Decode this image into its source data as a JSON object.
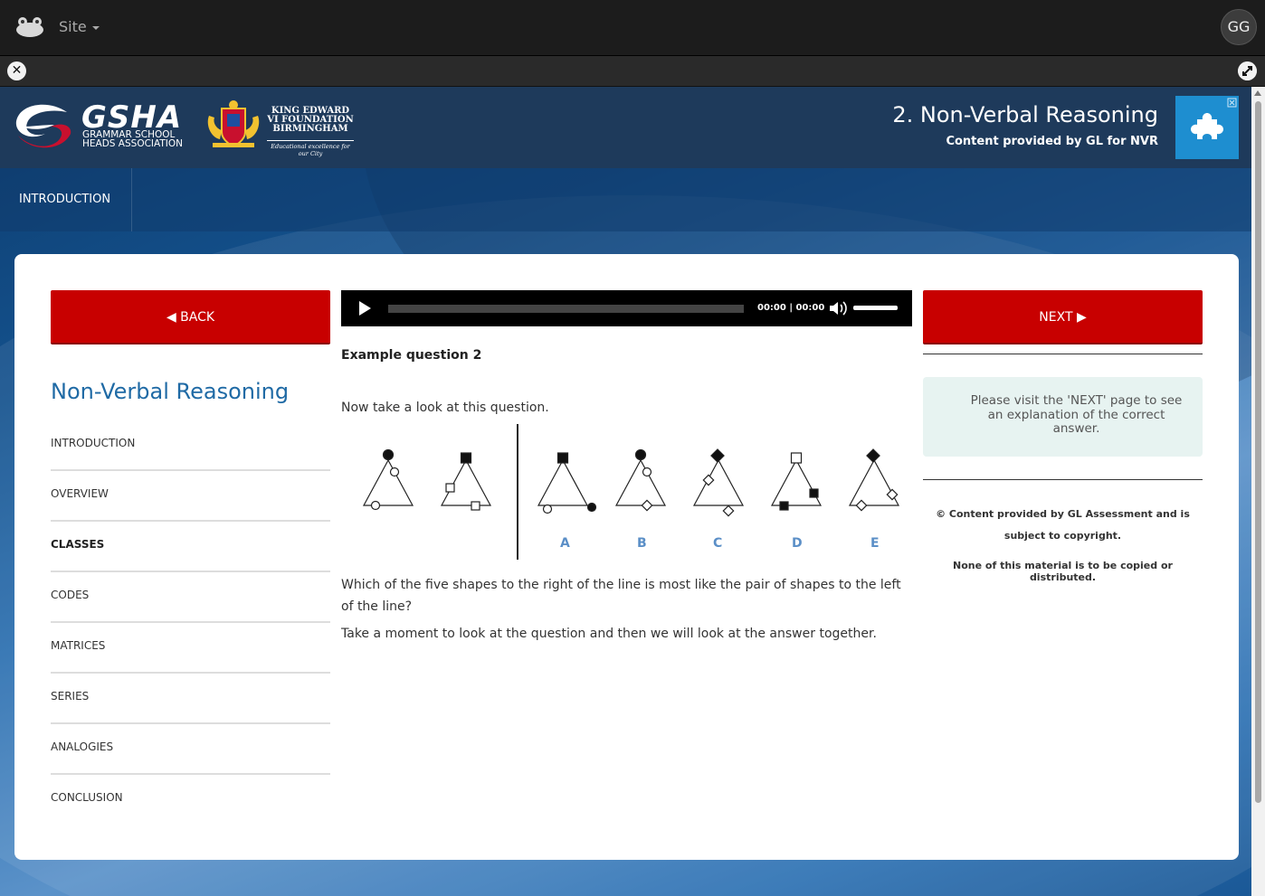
{
  "topbar": {
    "site_label": "Site",
    "avatar_initials": "GG"
  },
  "header": {
    "gsha_logo_text": "GSHA",
    "gsha_subtitle": "GRAMMAR SCHOOL HEADS ASSOCIATION",
    "kes_name": "KING EDWARD VI FOUNDATION BIRMINGHAM",
    "kes_tagline": "Educational excellence for our City",
    "title": "2. Non-Verbal Reasoning",
    "subtitle": "Content provided by GL for NVR",
    "tile_icon": "puzzle-icon"
  },
  "nav": {
    "active_tab": "INTRODUCTION"
  },
  "left": {
    "back_label": "◀ BACK",
    "section_title": "Non-Verbal Reasoning",
    "items": [
      {
        "label": "INTRODUCTION"
      },
      {
        "label": "OVERVIEW"
      },
      {
        "label": "CLASSES"
      },
      {
        "label": "CODES"
      },
      {
        "label": "MATRICES"
      },
      {
        "label": "SERIES"
      },
      {
        "label": "ANALOGIES"
      },
      {
        "label": "CONCLUSION"
      }
    ],
    "active_item": "CLASSES"
  },
  "player": {
    "time": "00:00 | 00:00"
  },
  "question": {
    "heading": "Example question 2",
    "intro": "Now take a look at this question.",
    "option_labels": [
      "A",
      "B",
      "C",
      "D",
      "E"
    ],
    "text": "Which of the five shapes to the right of the line is most like the pair of shapes to the left of the line?",
    "text2": "Take a moment to look at the question and then we will look at the answer together."
  },
  "right": {
    "next_label": "NEXT ▶",
    "info": "Please visit the 'NEXT' page to see an explanation of the correct answer.",
    "copyright": "© Content provided by GL Assessment and is subject to copyright.",
    "notice": "None of this material is to be copied or distributed."
  },
  "colors": {
    "button_red": "#c80000",
    "title_blue": "#1f6aa5",
    "label_blue": "#5b8fc7",
    "info_bg": "#e7f3f1"
  }
}
